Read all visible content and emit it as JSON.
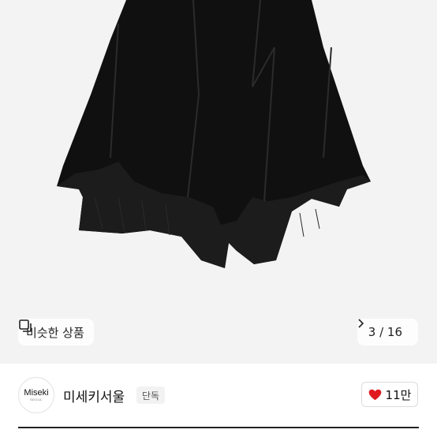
{
  "product_image": {
    "description_icon": "black-asymmetric-skirt"
  },
  "similar_button": {
    "label": "비슷한 상품",
    "icon": "similar-items-icon"
  },
  "image_counter": {
    "text": "3 / 16",
    "next_icon": "chevron-right-icon"
  },
  "seller": {
    "logo_text": "Miseki",
    "logo_sub": "SEOUL",
    "name": "미세키서울",
    "badge": "단독"
  },
  "like": {
    "count": "11만",
    "icon": "heart-icon",
    "color": "#e0191e"
  }
}
